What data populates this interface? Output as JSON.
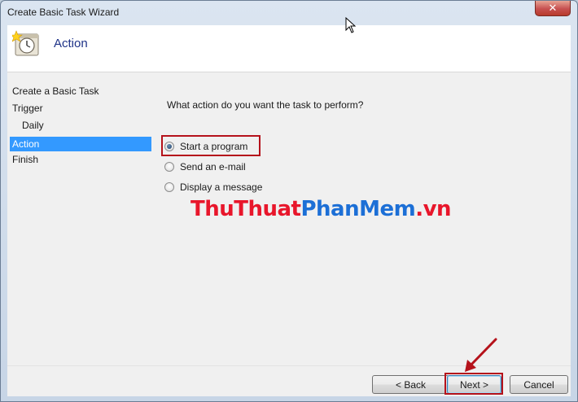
{
  "window": {
    "title": "Create Basic Task Wizard",
    "close_glyph": "✕"
  },
  "header": {
    "icon": "task-scheduler-clock-icon",
    "title": "Action"
  },
  "nav": {
    "items": [
      {
        "label": "Create a Basic Task",
        "sub": false,
        "active": false
      },
      {
        "label": "Trigger",
        "sub": false,
        "active": false
      },
      {
        "label": "Daily",
        "sub": true,
        "active": false
      },
      {
        "label": "Action",
        "sub": false,
        "active": true
      },
      {
        "label": "Finish",
        "sub": false,
        "active": false
      }
    ]
  },
  "main": {
    "question": "What action do you want the task to perform?",
    "options": [
      {
        "label": "Start a program",
        "checked": true
      },
      {
        "label": "Send an e-mail",
        "checked": false
      },
      {
        "label": "Display a message",
        "checked": false
      }
    ]
  },
  "watermark": {
    "part1": "ThuThuat",
    "part2": "PhanMem",
    "part3": ".vn"
  },
  "footer": {
    "back_label": "< Back",
    "next_label": "Next >",
    "cancel_label": "Cancel"
  },
  "colors": {
    "annotation": "#b5121b",
    "selection": "#3399ff",
    "watermark_red": "#e8162b",
    "watermark_blue": "#1c6fd6"
  }
}
